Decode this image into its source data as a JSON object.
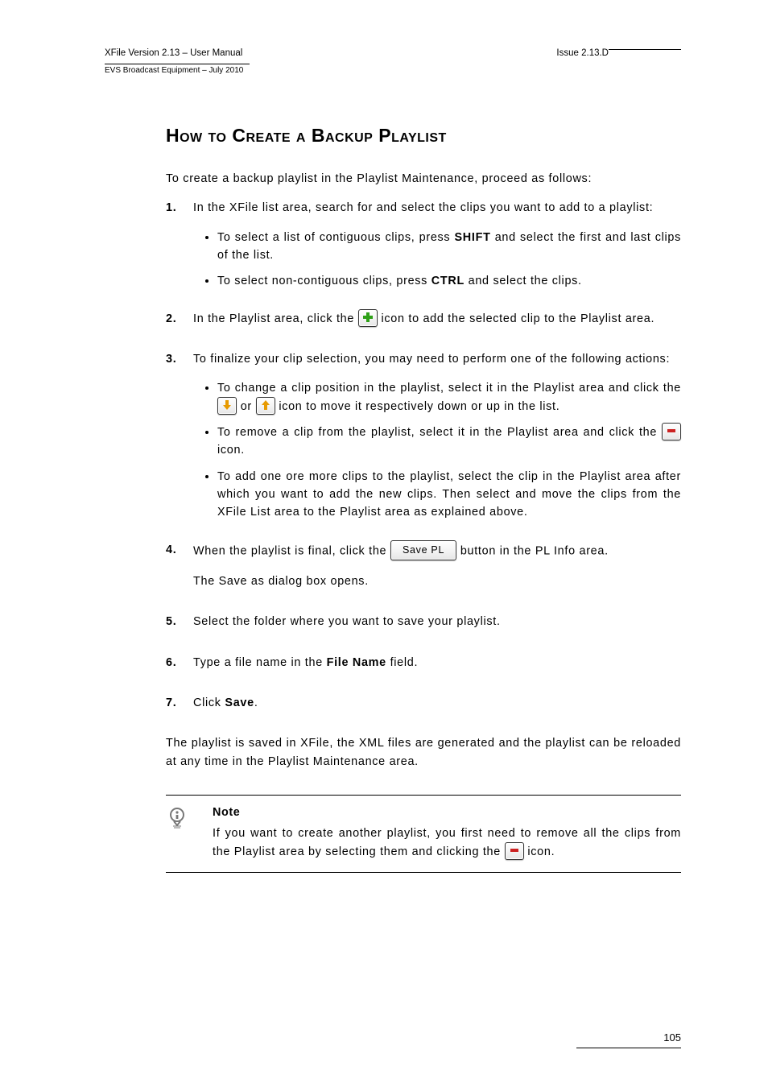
{
  "header": {
    "product": "XFile Version 2.13 – User Manual",
    "company": "EVS Broadcast Equipment – July 2010",
    "issue": "Issue 2.13.D"
  },
  "title": "How to Create a Backup Playlist",
  "intro": "To create a backup playlist in the Playlist Maintenance, proceed as follows:",
  "steps": {
    "s1": {
      "num": "1.",
      "text": "In the XFile list area, search for and select the clips you want to add to a playlist:",
      "sub1_a": "To select a list of contiguous clips, press ",
      "sub1_shift": "SHIFT",
      "sub1_b": " and select the first and last clips of the list.",
      "sub2_a": "To select non-contiguous clips, press ",
      "sub2_ctrl": "CTRL",
      "sub2_b": " and select the clips."
    },
    "s2": {
      "num": "2.",
      "a": "In the Playlist area, click the ",
      "b": " icon to add the selected clip to the Playlist area."
    },
    "s3": {
      "num": "3.",
      "text": "To finalize your clip selection, you may need to perform one of the following actions:",
      "sub1_a": "To change a clip position in the playlist, select it in the Playlist area and click the ",
      "sub1_b": " or ",
      "sub1_c": " icon to move it respectively down or up in the list.",
      "sub2_a": "To remove a clip from the playlist, select it in the Playlist area and click the ",
      "sub2_b": " icon.",
      "sub3": "To add one ore more clips to the playlist, select the clip in the Playlist area after which you want to add the new clips. Then select and move the clips from the XFile List area to the Playlist area as explained above."
    },
    "s4": {
      "num": "4.",
      "a": "When the playlist is final, click the ",
      "save_label": "Save PL",
      "b": " button in the PL Info area.",
      "c": "The Save as dialog box opens."
    },
    "s5": {
      "num": "5.",
      "text": "Select the folder where you want to save your playlist."
    },
    "s6": {
      "num": "6.",
      "a": "Type a file name in the ",
      "fn": "File Name",
      "b": " field."
    },
    "s7": {
      "num": "7.",
      "a": "Click ",
      "save": "Save",
      "b": "."
    }
  },
  "outro": "The playlist is saved in XFile, the XML files are generated and the playlist can be reloaded at any time in the Playlist Maintenance area.",
  "note": {
    "title": "Note",
    "a": "If you want to create another playlist, you first need to remove all the clips from the Playlist area by selecting them and clicking the ",
    "b": " icon."
  },
  "footer": {
    "page": "105"
  }
}
